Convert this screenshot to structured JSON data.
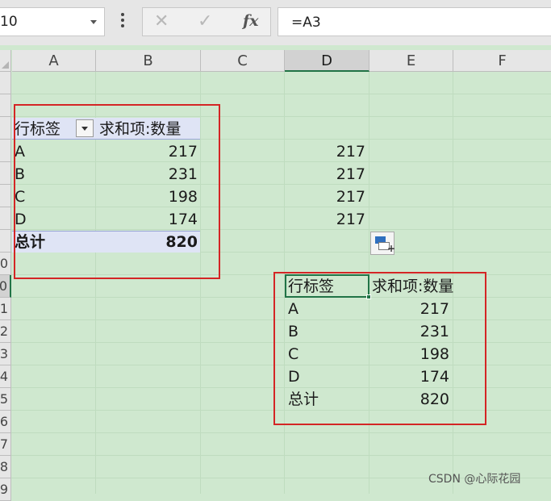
{
  "name_box": {
    "value": "10"
  },
  "formula_bar": {
    "fx_label": "fx",
    "cancel_glyph": "✕",
    "enter_glyph": "✓",
    "formula": "=A3"
  },
  "columns": [
    "A",
    "B",
    "C",
    "D",
    "E",
    "F"
  ],
  "selected_column": "D",
  "rows": [
    "",
    "",
    "",
    "",
    "",
    "",
    "",
    "",
    "0",
    "1",
    "2",
    "3",
    "4",
    "5",
    "6",
    "7",
    "8",
    "9"
  ],
  "selected_row": "0",
  "pivot_table": {
    "row_label_header": "行标签",
    "value_header": "求和项:数量",
    "rows": [
      {
        "label": "A",
        "value": "217"
      },
      {
        "label": "B",
        "value": "231"
      },
      {
        "label": "C",
        "value": "198"
      },
      {
        "label": "D",
        "value": "174"
      }
    ],
    "total_label": "总计",
    "total_value": "820"
  },
  "column_d_values": [
    "217",
    "217",
    "217",
    "217"
  ],
  "copied_table": {
    "row_label_header": "行标签",
    "value_header": "求和项:数量",
    "rows": [
      {
        "label": "A",
        "value": "217"
      },
      {
        "label": "B",
        "value": "231"
      },
      {
        "label": "C",
        "value": "198"
      },
      {
        "label": "D",
        "value": "174"
      },
      {
        "label": "总计",
        "value": "820"
      }
    ]
  },
  "watermark": "CSDN @心际花园",
  "colors": {
    "grid_bg": "#cfe8cf",
    "selection": "#217346",
    "highlight_box": "#d42525",
    "pivot_header_bg": "#dfe4f5"
  },
  "icons": [
    "filter-dropdown-icon",
    "paste-options-icon",
    "cancel-icon",
    "enter-icon",
    "fx-icon"
  ]
}
